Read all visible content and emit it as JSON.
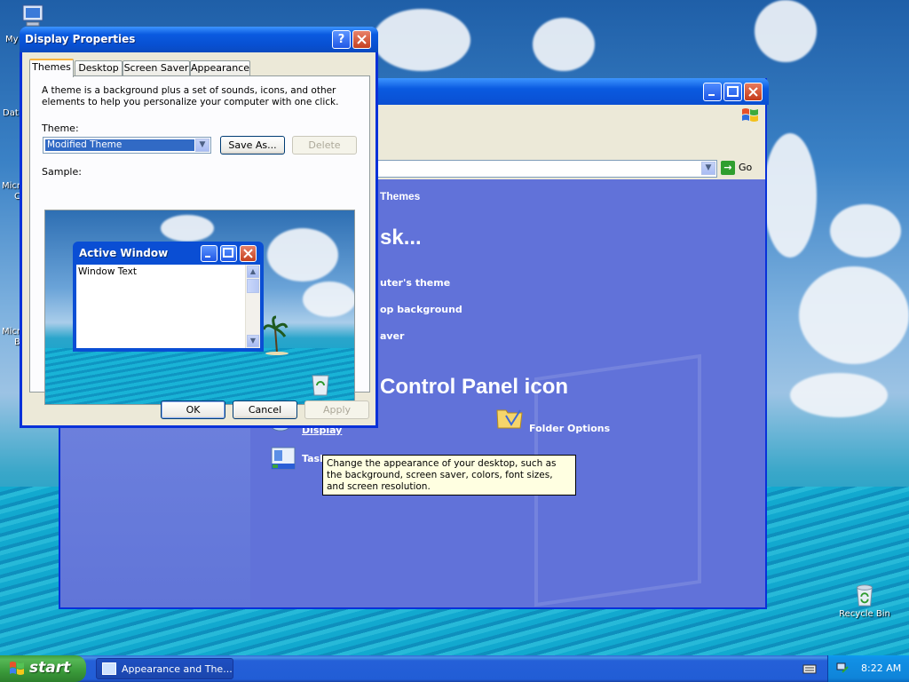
{
  "desktop": {
    "icons": [
      {
        "label": "My"
      },
      {
        "label": "Dat"
      },
      {
        "label": "Micr"
      },
      {
        "label": "C"
      },
      {
        "label": "Micr"
      },
      {
        "label": "B"
      }
    ],
    "recycle_bin": "Recycle Bin"
  },
  "control_panel": {
    "go_label": "Go",
    "breadcrumb_title": "Themes",
    "heading_task": "sk...",
    "tasks": [
      "uter's theme",
      "op background",
      "aver"
    ],
    "heading_icon": "Control Panel icon",
    "icons": [
      {
        "label": "Display"
      },
      {
        "label": "Folder Options"
      },
      {
        "label": "Task"
      }
    ]
  },
  "dialog": {
    "title": "Display Properties",
    "help": "?",
    "tabs": [
      "Themes",
      "Desktop",
      "Screen Saver",
      "Appearance"
    ],
    "active_tab": "Themes",
    "description": "A theme is a background plus a set of sounds, icons, and other elements to help you personalize your computer with one click.",
    "theme_label": "Theme:",
    "theme_value": "Modified Theme",
    "save_as": "Save As...",
    "delete": "Delete",
    "sample_label": "Sample:",
    "sample_window_title": "Active Window",
    "sample_window_text": "Window Text",
    "ok": "OK",
    "cancel": "Cancel",
    "apply": "Apply"
  },
  "tooltip": "Change the appearance of your desktop, such as the background, screen saver, colors, font sizes, and screen resolution.",
  "taskbar": {
    "start": "start",
    "task_item": "Appearance and The...",
    "clock": "8:22 AM"
  }
}
